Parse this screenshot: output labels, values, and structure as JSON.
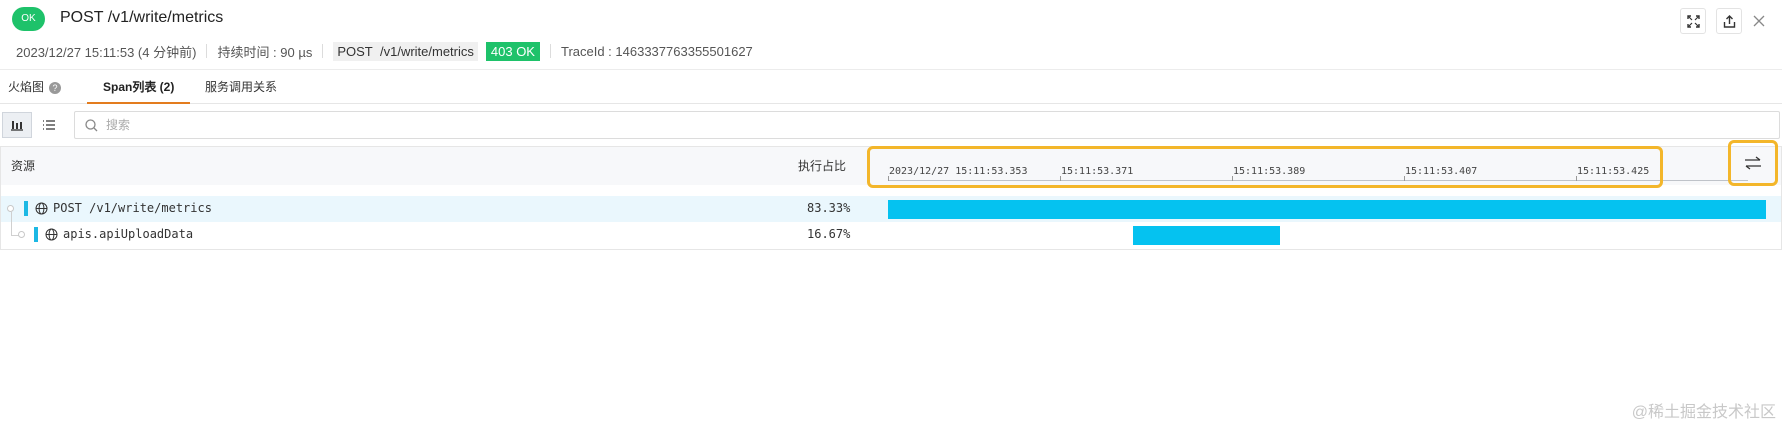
{
  "header": {
    "status_badge": "OK",
    "title": "POST /v1/write/metrics",
    "timestamp": "2023/12/27 15:11:53 (4 分钟前)",
    "duration": "持续时间 : 90 µs",
    "path_method": "POST",
    "path": "/v1/write/metrics",
    "status": "403 OK",
    "trace_id": "TraceId : 1463337763355501627",
    "icons": [
      "fullscreen-icon",
      "export-icon",
      "close-icon"
    ]
  },
  "tabs": [
    {
      "label": "火焰图",
      "active": false
    },
    {
      "label": "Span列表 (2)",
      "active": true
    },
    {
      "label": "服务调用关系",
      "active": false
    }
  ],
  "toolbar": {
    "view_icons": [
      "waterfall-icon",
      "list-icon"
    ],
    "search_placeholder": "搜索"
  },
  "table": {
    "col_resource": "资源",
    "col_ratio": "执行占比",
    "timeline_ticks": [
      "2023/12/27 15:11:53.353",
      "15:11:53.371",
      "15:11:53.389",
      "15:11:53.407",
      "15:11:53.425"
    ],
    "rows": [
      {
        "name": "POST /v1/write/metrics",
        "ratio": "83.33%",
        "bar_start": 0.0,
        "bar_fraction": 1.0,
        "highlighted": true
      },
      {
        "name": "apis.apiUploadData",
        "ratio": "16.67%",
        "bar_start": 0.279,
        "bar_fraction": 0.167,
        "highlighted": false
      }
    ]
  },
  "colors": {
    "ok_green": "#1ec26a",
    "accent_orange": "#e37c1e",
    "bar_blue": "#05c2f0",
    "highlight_box": "#f3b62a"
  },
  "watermark": "@稀土掘金技术社区"
}
